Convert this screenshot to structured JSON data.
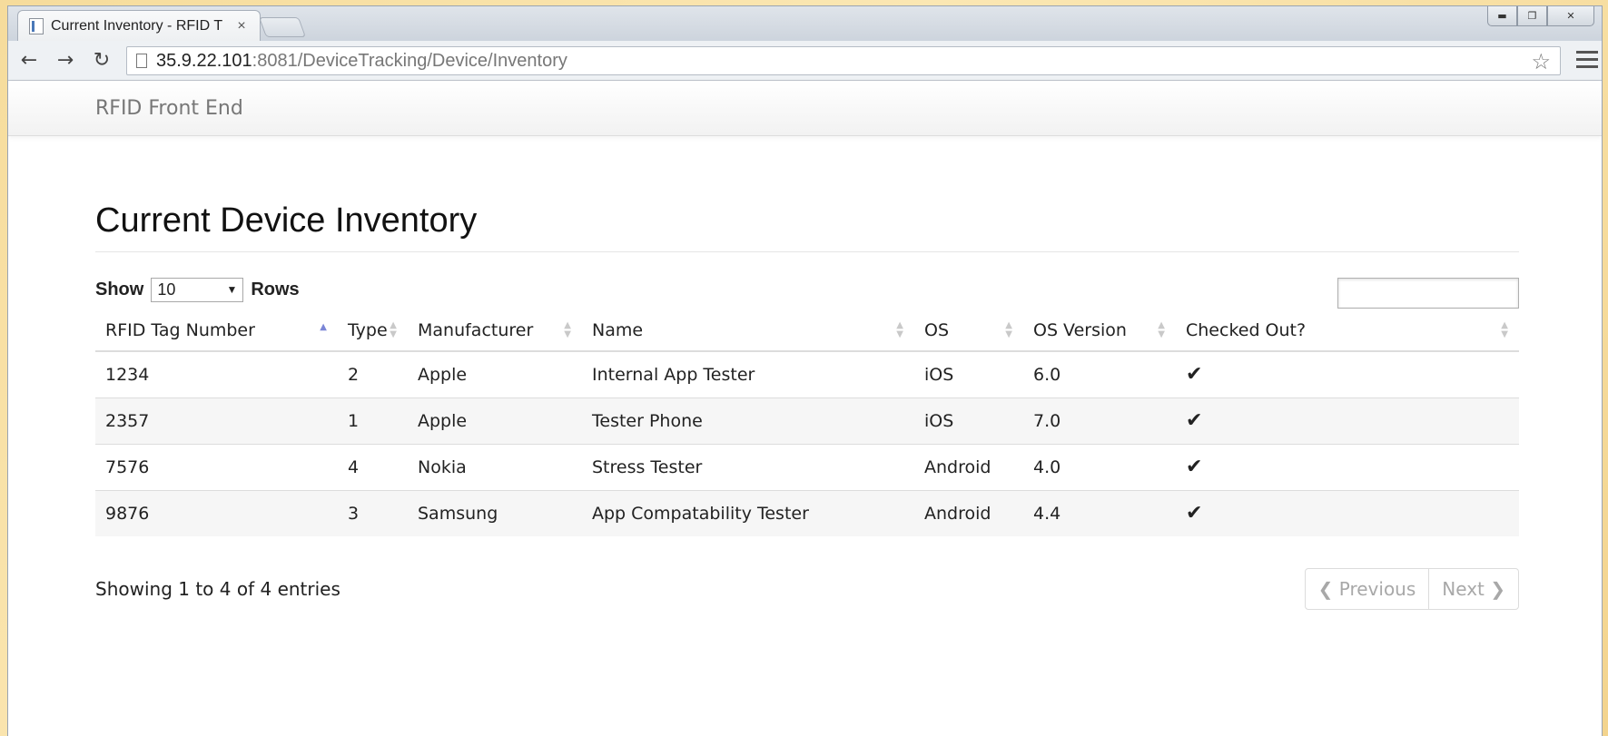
{
  "browser": {
    "tab_title": "Current Inventory - RFID T",
    "tab_close": "×",
    "url_host": "35.9.22.101",
    "url_rest": ":8081/DeviceTracking/Device/Inventory",
    "star_glyph": "☆",
    "back_glyph": "←",
    "forward_glyph": "→",
    "reload_glyph": "↻"
  },
  "navbar": {
    "brand": "RFID Front End"
  },
  "page": {
    "title": "Current Device Inventory",
    "show_label": "Show",
    "rows_label": "Rows",
    "page_size": "10",
    "search_value": ""
  },
  "table": {
    "columns": [
      "RFID Tag Number",
      "Type",
      "Manufacturer",
      "Name",
      "OS",
      "OS Version",
      "Checked Out?"
    ],
    "rows": [
      [
        "1234",
        "2",
        "Apple",
        "Internal App Tester",
        "iOS",
        "6.0",
        "✔"
      ],
      [
        "2357",
        "1",
        "Apple",
        "Tester Phone",
        "iOS",
        "7.0",
        "✔"
      ],
      [
        "7576",
        "4",
        "Nokia",
        "Stress Tester",
        "Android",
        "4.0",
        "✔"
      ],
      [
        "9876",
        "3",
        "Samsung",
        "App Compatability Tester",
        "Android",
        "4.4",
        "✔"
      ]
    ]
  },
  "footer": {
    "info": "Showing 1 to 4 of 4 entries",
    "previous": "Previous",
    "next": "Next"
  },
  "colors": {
    "sort_active": "#7a85d6",
    "background": "#f6dc9c"
  }
}
